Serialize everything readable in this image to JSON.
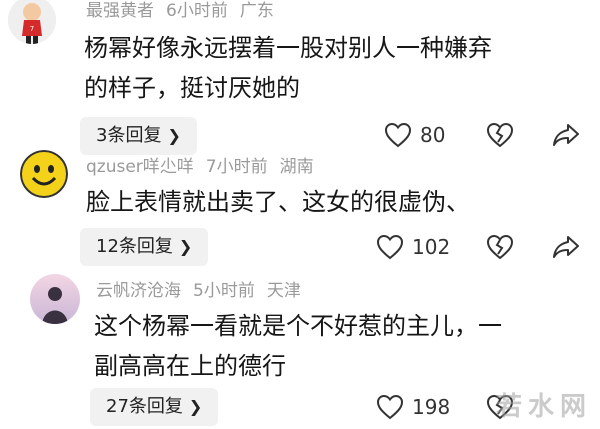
{
  "comments": [
    {
      "username": "最强黄者",
      "time": "6小时前",
      "location": "广东",
      "text_lines": [
        "杨幂好像永远摆着一股对别人一种嫌弃",
        "的样子，挺讨厌她的"
      ],
      "reply_label": "3条回复",
      "likes": "80"
    },
    {
      "username": "qzuser咩尐咩",
      "time": "7小时前",
      "location": "湖南",
      "text_lines": [
        "脸上表情就出卖了、这女的很虚伪、"
      ],
      "reply_label": "12条回复",
      "likes": "102"
    },
    {
      "username": "云帆济沧海",
      "time": "5小时前",
      "location": "天津",
      "text_lines": [
        "这个杨幂一看就是个不好惹的主儿，一",
        "副高高在上的德行"
      ],
      "reply_label": "27条回复",
      "likes": "198"
    }
  ],
  "icons": {
    "reply_chevron": "chevron-right-icon",
    "like": "heart-outline-icon",
    "dislike": "broken-heart-icon",
    "share": "share-arrow-icon"
  },
  "watermark": "若水网"
}
